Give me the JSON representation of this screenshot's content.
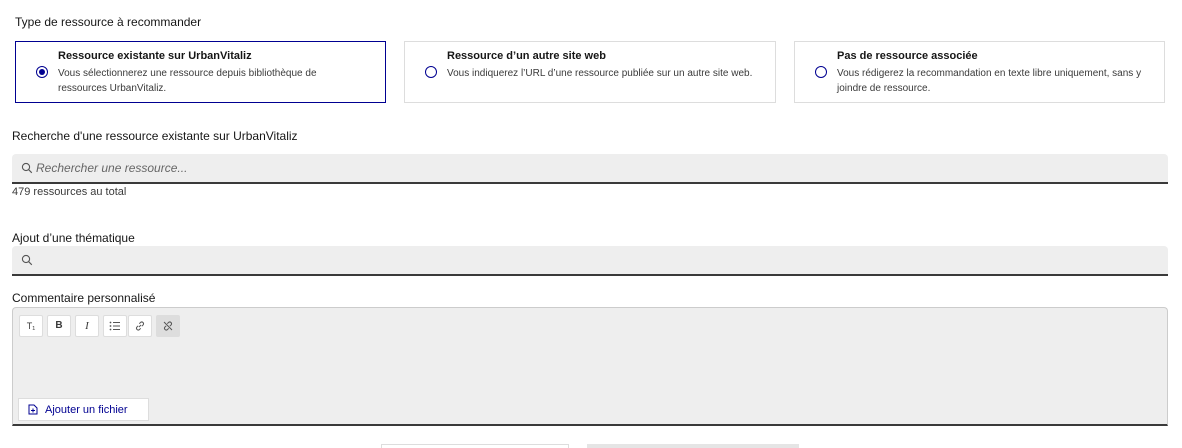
{
  "resource_type": {
    "label": "Type de ressource à recommander",
    "options": [
      {
        "title": "Ressource existante sur UrbanVitaliz",
        "description": "Vous sélectionnerez une ressource depuis bibliothèque de ressources UrbanVitaliz.",
        "selected": true
      },
      {
        "title": "Ressource d’un autre site web",
        "description": "Vous indiquerez l’URL d’une ressource publiée sur un autre site web.",
        "selected": false
      },
      {
        "title": "Pas de ressource associée",
        "description": "Vous rédigerez la recommandation en texte libre uniquement, sans y joindre de ressource.",
        "selected": false
      }
    ]
  },
  "search": {
    "label": "Recherche d'une ressource existante sur UrbanVitaliz",
    "placeholder": "Rechercher une ressource...",
    "count_text": "479 ressources au total"
  },
  "theme": {
    "label": "Ajout d’une thématique",
    "placeholder": ""
  },
  "comment": {
    "label": "Commentaire personnalisé",
    "toolbar": [
      {
        "name": "heading-button",
        "glyph": "T₁"
      },
      {
        "name": "bold-button",
        "glyph": "B"
      },
      {
        "name": "italic-button",
        "glyph": "I"
      },
      {
        "name": "bullet-list-button",
        "glyph": "☰"
      },
      {
        "name": "link-button",
        "glyph": "🔗"
      },
      {
        "name": "unlink-button",
        "glyph": "⛓"
      }
    ],
    "add_file_label": "Ajouter un fichier"
  },
  "colors": {
    "accent": "#000091",
    "field_bg": "#eeeeee"
  }
}
